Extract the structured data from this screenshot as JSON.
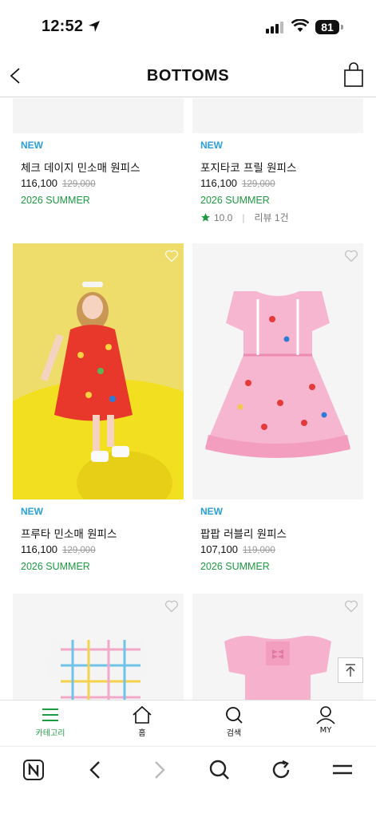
{
  "status_bar": {
    "time": "12:52",
    "battery": "81"
  },
  "header": {
    "title": "BOTTOMS",
    "back_icon": "chevron-left-icon",
    "bag_icon": "shopping-bag-icon"
  },
  "products": [
    {
      "badge": "NEW",
      "name": "체크 데이지 민소매 원피스",
      "price": "116,100",
      "original_price": "129,000",
      "season": "2026 SUMMER"
    },
    {
      "badge": "NEW",
      "name": "포지타코 프릴 원피스",
      "price": "116,100",
      "original_price": "129,000",
      "season": "2026 SUMMER",
      "rating": "10.0",
      "reviews": "리뷰 1건"
    },
    {
      "badge": "NEW",
      "name": "프루타 민소매 원피스",
      "price": "116,100",
      "original_price": "129,000",
      "season": "2026 SUMMER"
    },
    {
      "badge": "NEW",
      "name": "팝팝 러블리 원피스",
      "price": "107,100",
      "original_price": "119,000",
      "season": "2026 SUMMER"
    },
    {},
    {}
  ],
  "tabbar": [
    {
      "label": "카테고리",
      "icon": "menu-icon",
      "active": true,
      "color": "#1d9a42"
    },
    {
      "label": "홈",
      "icon": "home-icon"
    },
    {
      "label": "검색",
      "icon": "search-icon"
    },
    {
      "label": "MY",
      "icon": "user-icon"
    }
  ],
  "review_separator": "|",
  "colors": {
    "new_badge": "#2a9fd8",
    "season": "#1d9a42",
    "star": "#1d9a42"
  }
}
